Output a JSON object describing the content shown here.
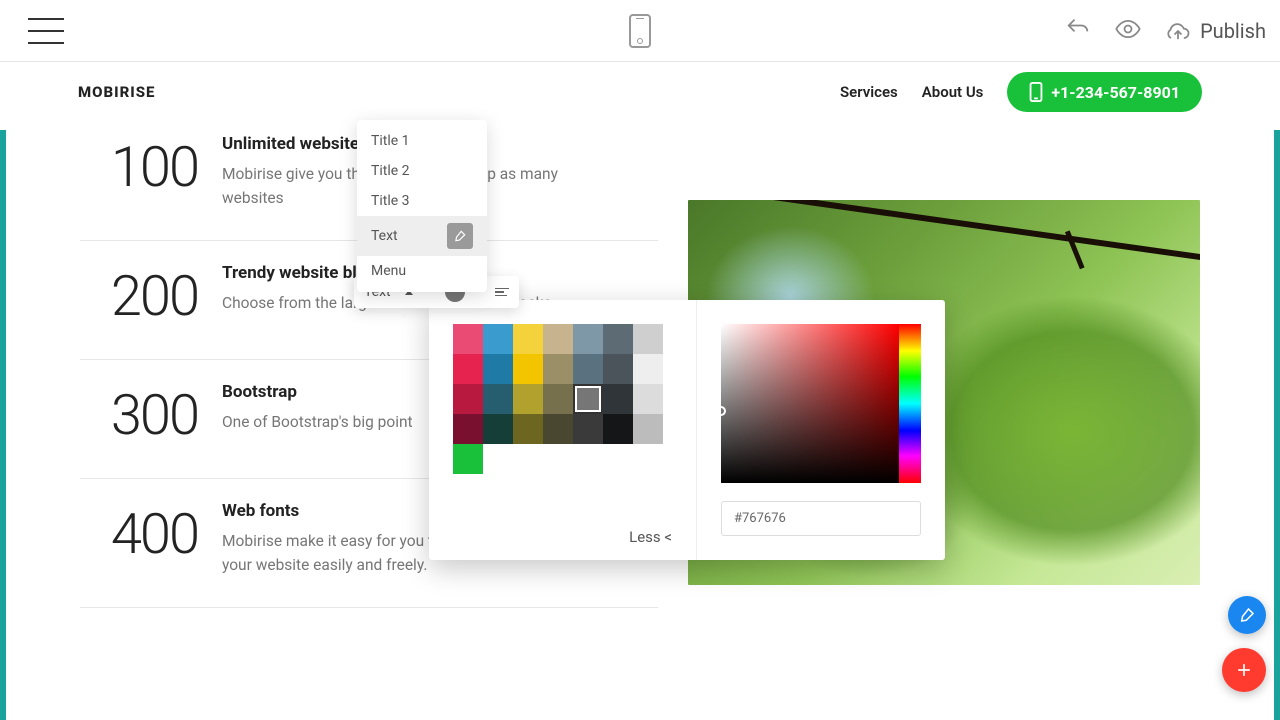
{
  "toolbar": {
    "publish_label": "Publish"
  },
  "header": {
    "brand": "MOBIRISE",
    "nav": {
      "services": "Services",
      "about": "About Us"
    },
    "phone": "+1-234-567-8901"
  },
  "features": [
    {
      "num": "100",
      "title": "Unlimited websites",
      "desc": "Mobirise give you the license to develop as many websites"
    },
    {
      "num": "200",
      "title": "Trendy website blocks",
      "desc": "Choose from the large selection of made blocks."
    },
    {
      "num": "300",
      "title": "Bootstrap",
      "desc": "One of Bootstrap's big point"
    },
    {
      "num": "400",
      "title": "Web fonts",
      "desc": "Mobirise make it easy for you to use Google fonts on your website easily and freely."
    }
  ],
  "style_menu": {
    "items": [
      "Title 1",
      "Title 2",
      "Title 3",
      "Text",
      "Menu"
    ],
    "selected_index": 3
  },
  "text_pop": {
    "label": "Text"
  },
  "picker": {
    "less_label": "Less <",
    "hex": "#767676",
    "swatches": [
      "#e94b74",
      "#3a9bcf",
      "#f4d23c",
      "#c7b48e",
      "#7e98a7",
      "#5d6c74",
      "#cfcfcf",
      "#e6224e",
      "#1f7aa6",
      "#f2c500",
      "#9a8f67",
      "#5a7280",
      "#4a545a",
      "#eeeeee",
      "#b71a3e",
      "#265e6f",
      "#b0a22c",
      "#76704d",
      "#767676",
      "#2f3538",
      "#dcdcdc",
      "#7a1030",
      "#153e39",
      "#6d6620",
      "#4a4730",
      "#3a3a3a",
      "#141618",
      "#bcbcbc"
    ],
    "extra_swatch": "#18c139",
    "selected_swatch_index": 18
  }
}
